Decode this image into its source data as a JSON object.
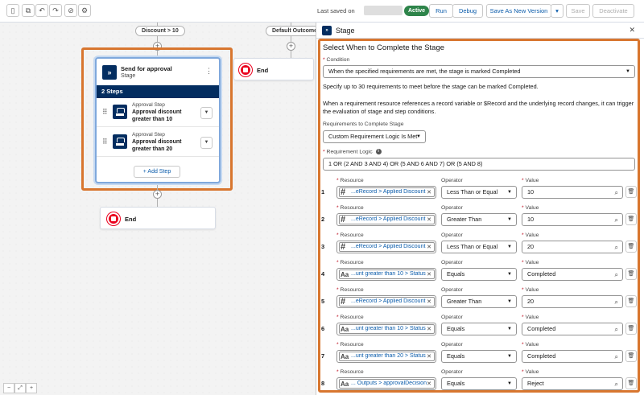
{
  "toolbar": {
    "last_saved_label": "Last saved on",
    "status": "Active",
    "run": "Run",
    "debug": "Debug",
    "save_as_new": "Save As New Version",
    "save": "Save",
    "deactivate": "Deactivate"
  },
  "canvas": {
    "branch_discount": "Discount > 10",
    "branch_default": "Default Outcome",
    "end_label": "End",
    "stage": {
      "title": "Send for approval",
      "subtitle": "Stage",
      "steps_count": "2 Steps",
      "steps": [
        {
          "type": "Approval Step",
          "name": "Approval discount greater than 10"
        },
        {
          "type": "Approval Step",
          "name": "Approval discount greater than 20"
        }
      ],
      "add_step": "+ Add Step"
    }
  },
  "panel": {
    "header": "Stage",
    "title": "Select When to Complete the Stage",
    "condition_label": "Condition",
    "condition_value": "When the specified requirements are met, the stage is marked Completed",
    "hint1": "Specify up to 30 requirements to meet before the stage can be marked Completed.",
    "hint2": "When a requirement resource references a record variable or $Record and the underlying record changes, it can trigger the evaluation of stage and step conditions.",
    "req_to_complete_label": "Requirements to Complete Stage",
    "req_to_complete_value": "Custom Requirement Logic Is Met",
    "logic_label": "Requirement Logic",
    "logic_value": "1 OR (2 AND 3 AND 4) OR (5 AND 6 AND 7) OR (5 AND 8)",
    "col_resource": "Resource",
    "col_operator": "Operator",
    "col_value": "Value",
    "rows": [
      {
        "num": "1",
        "kind": "num",
        "resource": "...eRecord > Applied Discount",
        "operator": "Less Than or Equal",
        "value": "10"
      },
      {
        "num": "2",
        "kind": "num",
        "resource": "...eRecord > Applied Discount",
        "operator": "Greater Than",
        "value": "10"
      },
      {
        "num": "3",
        "kind": "num",
        "resource": "...eRecord > Applied Discount",
        "operator": "Less Than or Equal",
        "value": "20"
      },
      {
        "num": "4",
        "kind": "text",
        "resource": "...unt greater than 10 > Status",
        "operator": "Equals",
        "value": "Completed"
      },
      {
        "num": "5",
        "kind": "num",
        "resource": "...eRecord > Applied Discount",
        "operator": "Greater Than",
        "value": "20"
      },
      {
        "num": "6",
        "kind": "text",
        "resource": "...unt greater than 10 > Status",
        "operator": "Equals",
        "value": "Completed"
      },
      {
        "num": "7",
        "kind": "text",
        "resource": "...unt greater than 20 > Status",
        "operator": "Equals",
        "value": "Completed"
      },
      {
        "num": "8",
        "kind": "text",
        "resource": "... Outputs > approvalDecision",
        "operator": "Equals",
        "value": "Reject"
      }
    ]
  }
}
